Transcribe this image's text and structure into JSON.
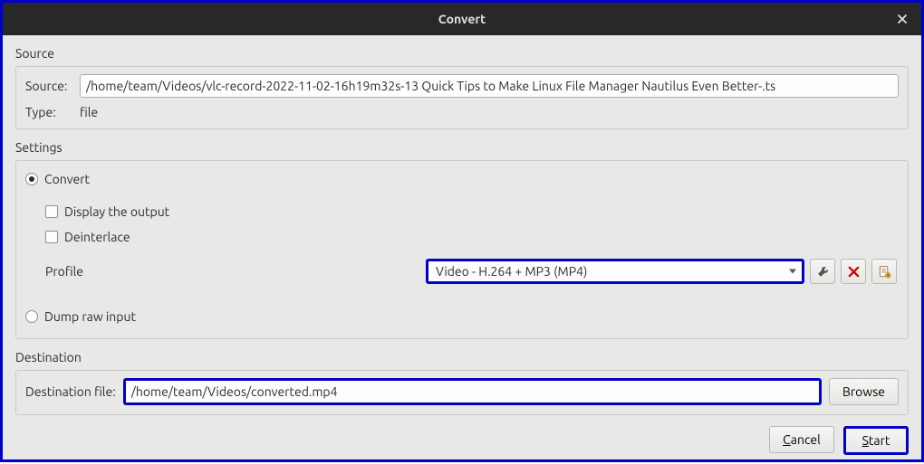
{
  "window": {
    "title": "Convert"
  },
  "source": {
    "heading": "Source",
    "source_label": "Source:",
    "source_value": "/home/team/Videos/vlc-record-2022-11-02-16h19m32s-13 Quick Tips to Make Linux File Manager Nautilus Even Better-.ts",
    "type_label": "Type:",
    "type_value": "file"
  },
  "settings": {
    "heading": "Settings",
    "convert_label": "Convert",
    "convert_checked": true,
    "display_output_label": "Display the output",
    "display_output_checked": false,
    "deinterlace_label": "Deinterlace",
    "deinterlace_checked": false,
    "profile_label": "Profile",
    "profile_selected": "Video - H.264 + MP3 (MP4)",
    "dump_label": "Dump raw input",
    "dump_checked": false
  },
  "destination": {
    "heading": "Destination",
    "file_label": "Destination file:",
    "file_value": "/home/team/Videos/converted.mp4",
    "browse_label": "Browse"
  },
  "footer": {
    "cancel_label": "Cancel",
    "cancel_mnemonic_index": 0,
    "start_label": "Start",
    "start_mnemonic_index": 0
  },
  "icons": {
    "wrench": "wrench-icon",
    "delete": "delete-icon",
    "new_profile": "new-profile-icon",
    "close": "close-icon"
  }
}
